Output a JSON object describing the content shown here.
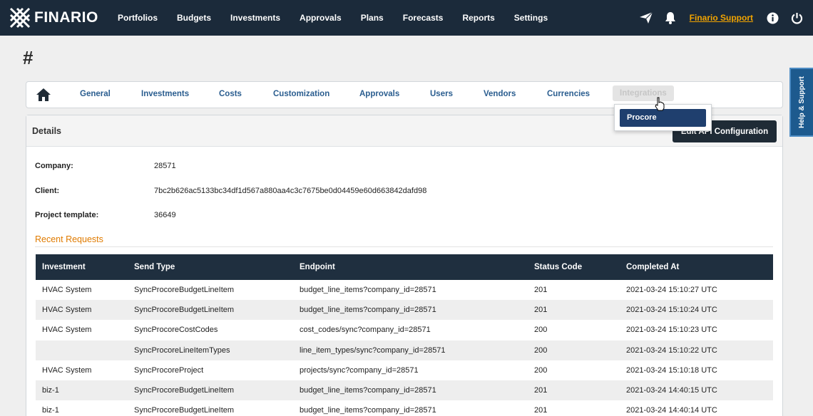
{
  "header": {
    "logo_text": "FINARIO",
    "nav": [
      "Portfolios",
      "Budgets",
      "Investments",
      "Approvals",
      "Plans",
      "Forecasts",
      "Reports",
      "Settings"
    ],
    "support_link": "Finario Support",
    "icons": [
      "paper-plane-icon",
      "bell-icon",
      "info-icon",
      "power-icon"
    ]
  },
  "page": {
    "title": "#"
  },
  "help_tab": "Help & Support",
  "subnav": {
    "items": [
      "General",
      "Investments",
      "Costs",
      "Customization",
      "Approvals",
      "Users",
      "Vendors",
      "Currencies",
      "Integrations"
    ],
    "active": "Integrations"
  },
  "dropdown": {
    "items": [
      "Procore"
    ]
  },
  "details": {
    "title": "Details",
    "edit_button": "Edit API Configuration",
    "fields": [
      {
        "label": "Company:",
        "value": "28571"
      },
      {
        "label": "Client:",
        "value": "7bc2b626ac5133bc34df1d567a880aa4c3c7675be0d04459e60d663842dafd98"
      },
      {
        "label": "Project template:",
        "value": "36649"
      }
    ]
  },
  "recent": {
    "title": "Recent Requests",
    "columns": [
      "Investment",
      "Send Type",
      "Endpoint",
      "Status Code",
      "Completed At"
    ],
    "rows": [
      [
        "HVAC System",
        "SyncProcoreBudgetLineItem",
        "budget_line_items?company_id=28571",
        "201",
        "2021-03-24 15:10:27 UTC"
      ],
      [
        "HVAC System",
        "SyncProcoreBudgetLineItem",
        "budget_line_items?company_id=28571",
        "201",
        "2021-03-24 15:10:24 UTC"
      ],
      [
        "HVAC System",
        "SyncProcoreCostCodes",
        "cost_codes/sync?company_id=28571",
        "200",
        "2021-03-24 15:10:23 UTC"
      ],
      [
        "",
        "SyncProcoreLineItemTypes",
        "line_item_types/sync?company_id=28571",
        "200",
        "2021-03-24 15:10:22 UTC"
      ],
      [
        "HVAC System",
        "SyncProcoreProject",
        "projects/sync?company_id=28571",
        "200",
        "2021-03-24 15:10:18 UTC"
      ],
      [
        "biz-1",
        "SyncProcoreBudgetLineItem",
        "budget_line_items?company_id=28571",
        "201",
        "2021-03-24 14:40:15 UTC"
      ],
      [
        "biz-1",
        "SyncProcoreBudgetLineItem",
        "budget_line_items?company_id=28571",
        "201",
        "2021-03-24 14:40:14 UTC"
      ]
    ]
  },
  "colors": {
    "nav_bg": "#1b2a3a",
    "accent_orange": "#e07b00",
    "link_blue": "#2a5d8f",
    "help_blue": "#1d5a8e"
  }
}
